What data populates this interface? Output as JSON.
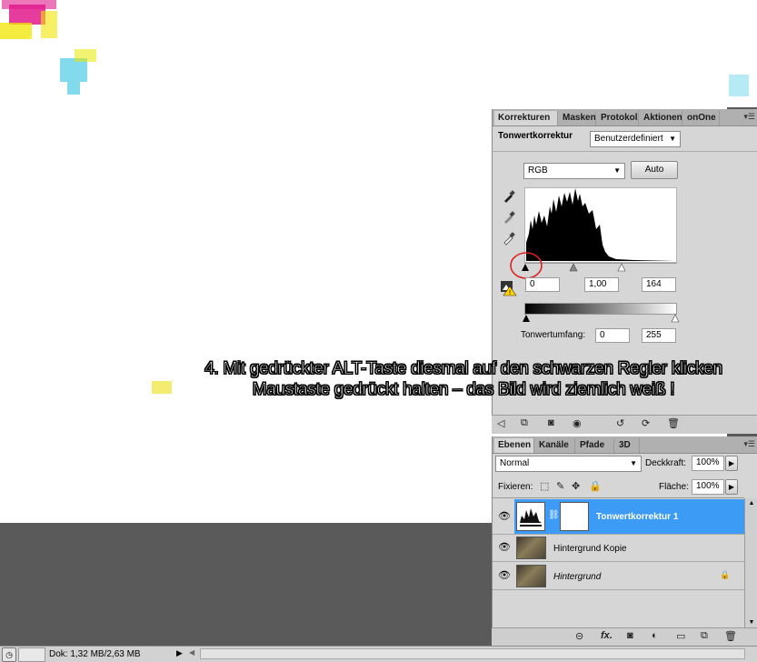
{
  "overlay": {
    "line1": "4. Mit gedrückter ALT-Taste diesmal auf den schwarzen Regler klicken",
    "line2": "Maustaste gedrückt halten – das Bild wird ziemlich weiß !"
  },
  "adjustments_panel": {
    "tabs": [
      "Korrekturen",
      "Masken",
      "Protokoll",
      "Aktionen",
      "onOne"
    ],
    "active_tab": "Korrekturen",
    "title": "Tonwertkorrektur",
    "preset_value": "Benutzerdefiniert",
    "channel_value": "RGB",
    "auto_label": "Auto",
    "input_levels": {
      "black": "0",
      "gamma": "1,00",
      "white": "164"
    },
    "output_label": "Tonwertumfang:",
    "output_levels": {
      "black": "0",
      "white": "255"
    },
    "histogram_icons": [
      "black-eyedropper-icon",
      "gray-eyedropper-icon",
      "white-eyedropper-icon",
      "clipping-warning-icon"
    ],
    "footer_icons": [
      "back-arrow-icon",
      "clip-to-layer-icon",
      "layer-mask-toggle-icon",
      "visibility-icon",
      "previous-state-icon",
      "reset-icon",
      "delete-icon"
    ]
  },
  "layers_panel": {
    "tabs": [
      "Ebenen",
      "Kanäle",
      "Pfade",
      "3D"
    ],
    "active_tab": "Ebenen",
    "blend_mode": "Normal",
    "opacity_label": "Deckkraft:",
    "opacity_value": "100%",
    "lock_label": "Fixieren:",
    "fill_label": "Fläche:",
    "fill_value": "100%",
    "layers": [
      {
        "name": "Tonwertkorrektur 1",
        "selected": true
      },
      {
        "name": "Hintergrund Kopie",
        "selected": false
      },
      {
        "name": "Hintergrund",
        "selected": false,
        "locked": true
      }
    ],
    "footer_icons": [
      "link-icon",
      "fx-icon",
      "add-mask-icon",
      "adjustment-layer-icon",
      "group-icon",
      "new-layer-icon",
      "trash-icon"
    ]
  },
  "status_bar": {
    "doc_info": "Dok: 1,32 MB/2,63 MB"
  },
  "colors": {
    "selected_layer": "#3c9bf5",
    "annotation_circle": "#e02020",
    "workspace": "#5a5a5a"
  }
}
